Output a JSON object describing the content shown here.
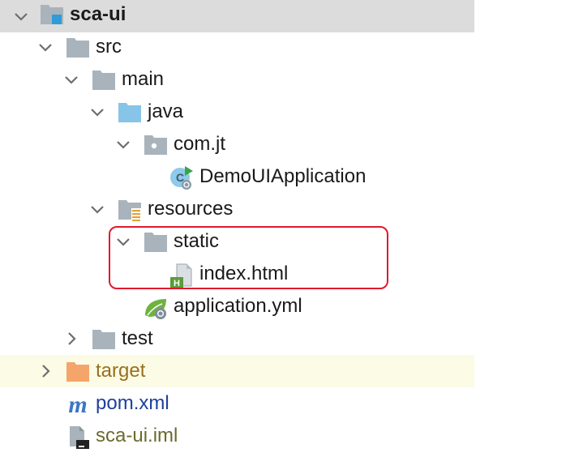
{
  "tree": {
    "root": {
      "label": "sca-ui"
    },
    "src": {
      "label": "src"
    },
    "main": {
      "label": "main"
    },
    "java": {
      "label": "java"
    },
    "package": {
      "label": "com.jt"
    },
    "app_class": {
      "label": "DemoUIApplication"
    },
    "resources": {
      "label": "resources"
    },
    "static": {
      "label": "static"
    },
    "index": {
      "label": "index.html"
    },
    "app_yml": {
      "label": "application.yml"
    },
    "test": {
      "label": "test"
    },
    "target": {
      "label": "target"
    },
    "pom": {
      "label": "pom.xml"
    },
    "iml": {
      "label": "sca-ui.iml"
    }
  },
  "icons": {
    "expanded": "chevron-down-icon",
    "collapsed": "chevron-right-icon",
    "module": "module-folder-icon",
    "folder": "folder-icon",
    "source_root": "source-folder-icon",
    "package": "package-icon",
    "spring_class": "spring-boot-class-icon",
    "resources_root": "resources-folder-icon",
    "html_file": "html-file-icon",
    "spring_config": "spring-config-icon",
    "excluded_folder": "excluded-folder-icon",
    "maven": "maven-icon",
    "iml_file": "iml-file-icon"
  },
  "colors": {
    "selection": "#dcdcdc",
    "excluded_row": "#fbfbe6",
    "highlight_border": "#e0192f",
    "folder_gray": "#a9b3bb",
    "source_blue": "#87c5e8",
    "excluded_orange": "#f5a56a"
  }
}
